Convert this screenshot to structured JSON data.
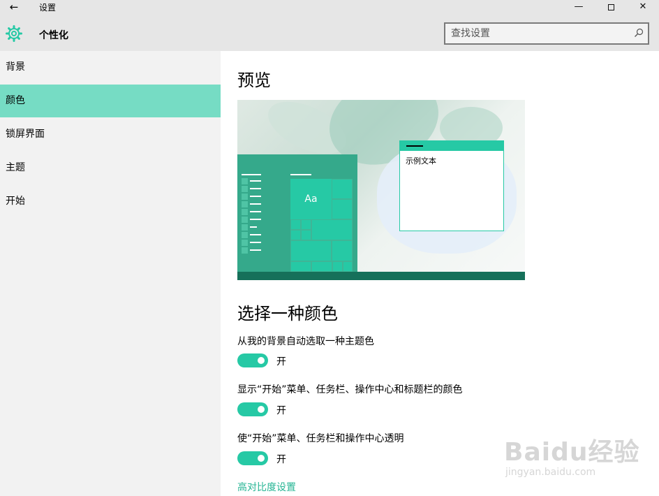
{
  "window": {
    "back_glyph": "←",
    "title": "设置",
    "min_glyph": "—",
    "close_glyph": "✕"
  },
  "header": {
    "icon": "gear-icon",
    "title": "个性化",
    "search_placeholder": "查找设置"
  },
  "sidebar": {
    "items": [
      {
        "label": "背景",
        "active": false
      },
      {
        "label": "颜色",
        "active": true
      },
      {
        "label": "锁屏界面",
        "active": false
      },
      {
        "label": "主题",
        "active": false
      },
      {
        "label": "开始",
        "active": false
      }
    ]
  },
  "main": {
    "preview_title": "预览",
    "preview": {
      "tile_label": "Aa",
      "sample_text": "示例文本"
    },
    "color_title": "选择一种颜色",
    "options": [
      {
        "label": "从我的背景自动选取一种主题色",
        "state": "开"
      },
      {
        "label": "显示“开始”菜单、任务栏、操作中心和标题栏的颜色",
        "state": "开"
      },
      {
        "label": "使“开始”菜单、任务栏和操作中心透明",
        "state": "开"
      }
    ],
    "link": "高对比度设置"
  },
  "colors": {
    "accent": "#26c9a5",
    "active_nav": "#76dcc4",
    "link": "#26b594"
  },
  "watermark": {
    "text": "Baidu经验",
    "sub": "jingyan.baidu.com"
  }
}
